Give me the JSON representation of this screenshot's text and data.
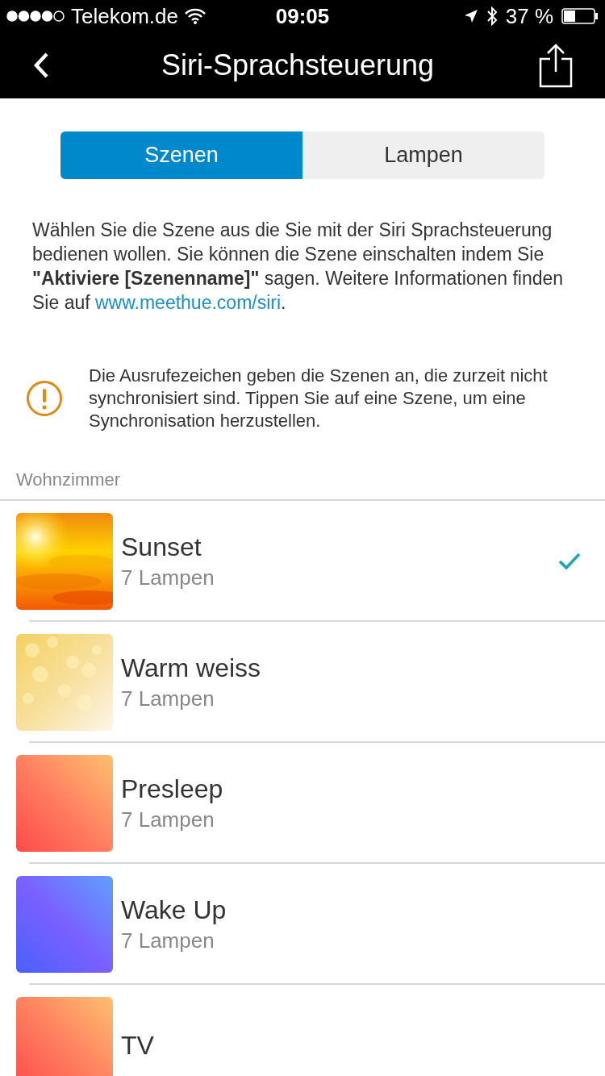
{
  "status_bar": {
    "carrier": "Telekom.de",
    "time": "09:05",
    "battery": "37 %"
  },
  "nav": {
    "title": "Siri-Sprachsteuerung"
  },
  "tabs": [
    {
      "label": "Szenen",
      "selected": true
    },
    {
      "label": "Lampen",
      "selected": false
    }
  ],
  "intro": {
    "text": "Wählen Sie die Szene aus die Sie mit der Siri Sprachsteuerung bedienen wollen. Sie können die Szene einschalten indem Sie **\"Aktiviere [Szenenname]\"** sagen. Weitere Informationen finden Sie auf ",
    "link": "www.meethue.com/siri",
    "after": "."
  },
  "notice": "Die Ausrufezeichen geben die Szenen an, die zurzeit nicht synchronisiert sind. Tippen Sie auf eine Szene, um eine Synchronisation herzustellen.",
  "section": "Wohnzimmer",
  "scenes": [
    {
      "name": "Sunset",
      "subtitle": "7 Lampen",
      "kind": "sunset",
      "selected": true
    },
    {
      "name": "Warm weiss",
      "subtitle": "7 Lampen",
      "kind": "bokeh",
      "selected": false
    },
    {
      "name": "Presleep",
      "subtitle": "7 Lampen",
      "kind": "warm",
      "selected": false
    },
    {
      "name": "Wake Up",
      "subtitle": "7 Lampen",
      "kind": "cool",
      "selected": false
    },
    {
      "name": "TV",
      "kind": "warm",
      "selected": false
    }
  ]
}
